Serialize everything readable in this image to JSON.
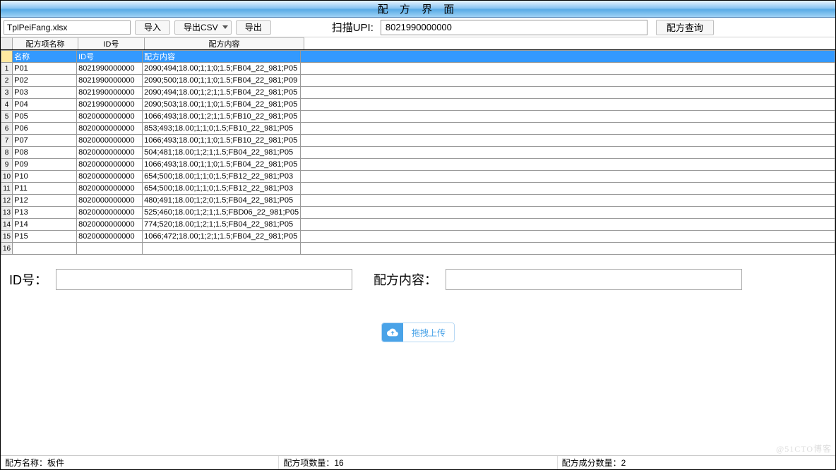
{
  "title": "配 方 界 面",
  "toolbar": {
    "filename": "TplPeiFang.xlsx",
    "import_label": "导入",
    "export_csv_label": "导出CSV",
    "export_label": "导出",
    "upi_label": "扫描UPI:",
    "upi_value": "8021990000000",
    "query_label": "配方查询"
  },
  "column_headers": {
    "name": "配方项名称",
    "id": "ID号",
    "content": "配方内容"
  },
  "selected_row": {
    "name": "名称",
    "id": "ID号",
    "content": "配方内容"
  },
  "rows": [
    {
      "n": "1",
      "name": "P01",
      "id": "8021990000000",
      "content": "2090;494;18.00;1;1;0;1.5;FB04_22_981;P05"
    },
    {
      "n": "2",
      "name": "P02",
      "id": "8021990000000",
      "content": "2090;500;18.00;1;1;0;1.5;FB04_22_981;P09"
    },
    {
      "n": "3",
      "name": "P03",
      "id": "8021990000000",
      "content": "2090;494;18.00;1;2;1;1.5;FB04_22_981;P05"
    },
    {
      "n": "4",
      "name": "P04",
      "id": "8021990000000",
      "content": "2090;503;18.00;1;1;0;1.5;FB04_22_981;P05"
    },
    {
      "n": "5",
      "name": "P05",
      "id": "8020000000000",
      "content": "1066;493;18.00;1;2;1;1.5;FB10_22_981;P05"
    },
    {
      "n": "6",
      "name": "P06",
      "id": "8020000000000",
      "content": "853;493;18.00;1;1;0;1.5;FB10_22_981;P05"
    },
    {
      "n": "7",
      "name": "P07",
      "id": "8020000000000",
      "content": "1066;493;18.00;1;1;0;1.5;FB10_22_981;P05"
    },
    {
      "n": "8",
      "name": "P08",
      "id": "8020000000000",
      "content": "504;481;18.00;1;2;1;1.5;FB04_22_981;P05"
    },
    {
      "n": "9",
      "name": "P09",
      "id": "8020000000000",
      "content": "1066;493;18.00;1;1;0;1.5;FB04_22_981;P05"
    },
    {
      "n": "10",
      "name": "P10",
      "id": "8020000000000",
      "content": "654;500;18.00;1;1;0;1.5;FB12_22_981;P03"
    },
    {
      "n": "11",
      "name": "P11",
      "id": "8020000000000",
      "content": "654;500;18.00;1;1;0;1.5;FB12_22_981;P03"
    },
    {
      "n": "12",
      "name": "P12",
      "id": "8020000000000",
      "content": "480;491;18.00;1;2;0;1.5;FB04_22_981;P05"
    },
    {
      "n": "13",
      "name": "P13",
      "id": "8020000000000",
      "content": "525;460;18.00;1;2;1;1.5;FBD06_22_981;P05"
    },
    {
      "n": "14",
      "name": "P14",
      "id": "8020000000000",
      "content": "774;520;18.00;1;2;1;1.5;FB04_22_981;P05"
    },
    {
      "n": "15",
      "name": "P15",
      "id": "8020000000000",
      "content": "1066;472;18.00;1;2;1;1.5;FB04_22_981;P05"
    }
  ],
  "form": {
    "id_label": "ID号：",
    "content_label": "配方内容："
  },
  "upload": {
    "label": "拖拽上传"
  },
  "statusbar": {
    "name_label": "配方名称：",
    "name_value": "板件",
    "count_label": "配方项数量：",
    "count_value": "16",
    "comp_label": "配方成分数量：",
    "comp_value": "2"
  },
  "watermark": "@51CTO博客"
}
